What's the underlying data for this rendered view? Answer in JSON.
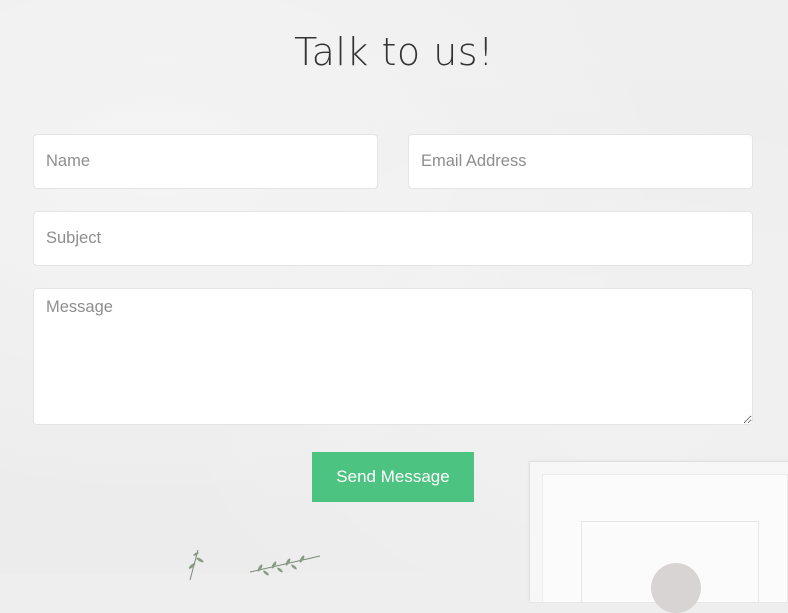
{
  "page": {
    "title": "Talk to us!"
  },
  "form": {
    "name_placeholder": "Name",
    "email_placeholder": "Email Address",
    "subject_placeholder": "Subject",
    "message_placeholder": "Message",
    "name_value": "",
    "email_value": "",
    "subject_value": "",
    "message_value": "",
    "submit_label": "Send Message"
  },
  "colors": {
    "accent": "#4cc380",
    "background": "#eeeeee",
    "title": "#333333"
  }
}
